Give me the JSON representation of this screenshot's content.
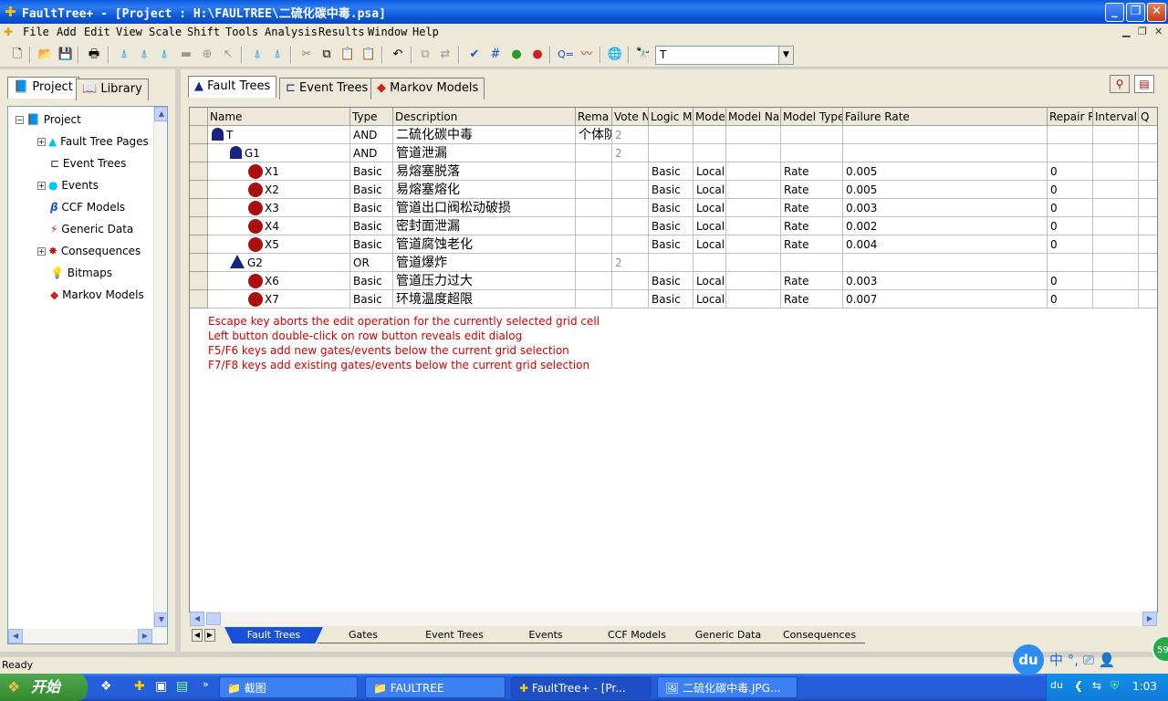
{
  "window": {
    "title": "FaultTree+ - [Project : H:\\FAULTREE\\二硫化碳中毒.psa]",
    "controls": [
      "_",
      "❐",
      "✕"
    ]
  },
  "menu": [
    "File",
    "Add",
    "Edit",
    "View",
    "Scale",
    "Shift",
    "Tools",
    "Analysis",
    "Results",
    "Window",
    "Help"
  ],
  "toolbar": {
    "search_value": "T"
  },
  "left_tabs": [
    "Project",
    "Library"
  ],
  "tree": {
    "root": "Project",
    "items": [
      "Fault Tree Pages",
      "Event Trees",
      "Events",
      "CCF Models",
      "Generic Data",
      "Consequences",
      "Bitmaps",
      "Markov Models"
    ]
  },
  "right_tabs": [
    "Fault Trees",
    "Event Trees",
    "Markov Models"
  ],
  "grid": {
    "columns": [
      "Name",
      "Type",
      "Description",
      "Rema",
      "Vote N",
      "Logic M",
      "Mode",
      "Model Na",
      "Model Type",
      "Failure Rate",
      "Repair R",
      "Interval",
      "Q"
    ],
    "rows": [
      {
        "name": "T",
        "kind": "and",
        "level": 0,
        "type": "AND",
        "desc": "二硫化碳中毒",
        "remark": "个体防",
        "vote": "2",
        "logic": "",
        "mode": "",
        "mtype": "",
        "rate": "",
        "repair": ""
      },
      {
        "name": "G1",
        "kind": "and",
        "level": 1,
        "type": "AND",
        "desc": "管道泄漏",
        "remark": "",
        "vote": "2",
        "logic": "",
        "mode": "",
        "mtype": "",
        "rate": "",
        "repair": ""
      },
      {
        "name": "X1",
        "kind": "basic",
        "level": 2,
        "type": "Basic",
        "desc": "易熔塞脱落",
        "remark": "",
        "vote": "",
        "logic": "Basic",
        "mode": "Local",
        "mtype": "Rate",
        "rate": "0.005",
        "repair": "0"
      },
      {
        "name": "X2",
        "kind": "basic",
        "level": 2,
        "type": "Basic",
        "desc": "易熔塞熔化",
        "remark": "",
        "vote": "",
        "logic": "Basic",
        "mode": "Local",
        "mtype": "Rate",
        "rate": "0.005",
        "repair": "0"
      },
      {
        "name": "X3",
        "kind": "basic",
        "level": 2,
        "type": "Basic",
        "desc": "管道出口阀松动破损",
        "remark": "",
        "vote": "",
        "logic": "Basic",
        "mode": "Local",
        "mtype": "Rate",
        "rate": "0.003",
        "repair": "0"
      },
      {
        "name": "X4",
        "kind": "basic",
        "level": 2,
        "type": "Basic",
        "desc": "密封面泄漏",
        "remark": "",
        "vote": "",
        "logic": "Basic",
        "mode": "Local",
        "mtype": "Rate",
        "rate": "0.002",
        "repair": "0"
      },
      {
        "name": "X5",
        "kind": "basic",
        "level": 2,
        "type": "Basic",
        "desc": "管道腐蚀老化",
        "remark": "",
        "vote": "",
        "logic": "Basic",
        "mode": "Local",
        "mtype": "Rate",
        "rate": "0.004",
        "repair": "0"
      },
      {
        "name": "G2",
        "kind": "or",
        "level": 1,
        "type": "OR",
        "desc": "管道爆炸",
        "remark": "",
        "vote": "2",
        "logic": "",
        "mode": "",
        "mtype": "",
        "rate": "",
        "repair": ""
      },
      {
        "name": "X6",
        "kind": "basic",
        "level": 2,
        "type": "Basic",
        "desc": "管道压力过大",
        "remark": "",
        "vote": "",
        "logic": "Basic",
        "mode": "Local",
        "mtype": "Rate",
        "rate": "0.003",
        "repair": "0"
      },
      {
        "name": "X7",
        "kind": "basic",
        "level": 2,
        "type": "Basic",
        "desc": "环境温度超限",
        "remark": "",
        "vote": "",
        "logic": "Basic",
        "mode": "Local",
        "mtype": "Rate",
        "rate": "0.007",
        "repair": "0"
      }
    ]
  },
  "hints": [
    "Escape key aborts the edit operation for the currently selected grid cell",
    "Left button double-click on row button reveals edit dialog",
    "F5/F6 keys add new gates/events below the current grid selection",
    "F7/F8 keys add existing gates/events below the current grid selection"
  ],
  "bottom_tabs": [
    "Fault Trees",
    "Gates",
    "Event Trees",
    "Events",
    "CCF Models",
    "Generic Data",
    "Consequences"
  ],
  "status": "Ready",
  "taskbar": {
    "start": "开始",
    "tasks": [
      "截图",
      "FAULTREE",
      "FaultTree+ - [Pr...",
      "二硫化碳中毒.JPG..."
    ],
    "clock": "1:03",
    "ime": "中 °,",
    "badge": "59"
  },
  "colors": {
    "title_blue": "#0a5adf",
    "hint_red": "#d00000",
    "event_red": "#a81010",
    "gate_navy": "#1a237e",
    "tab_blue": "#1a4fd8"
  }
}
